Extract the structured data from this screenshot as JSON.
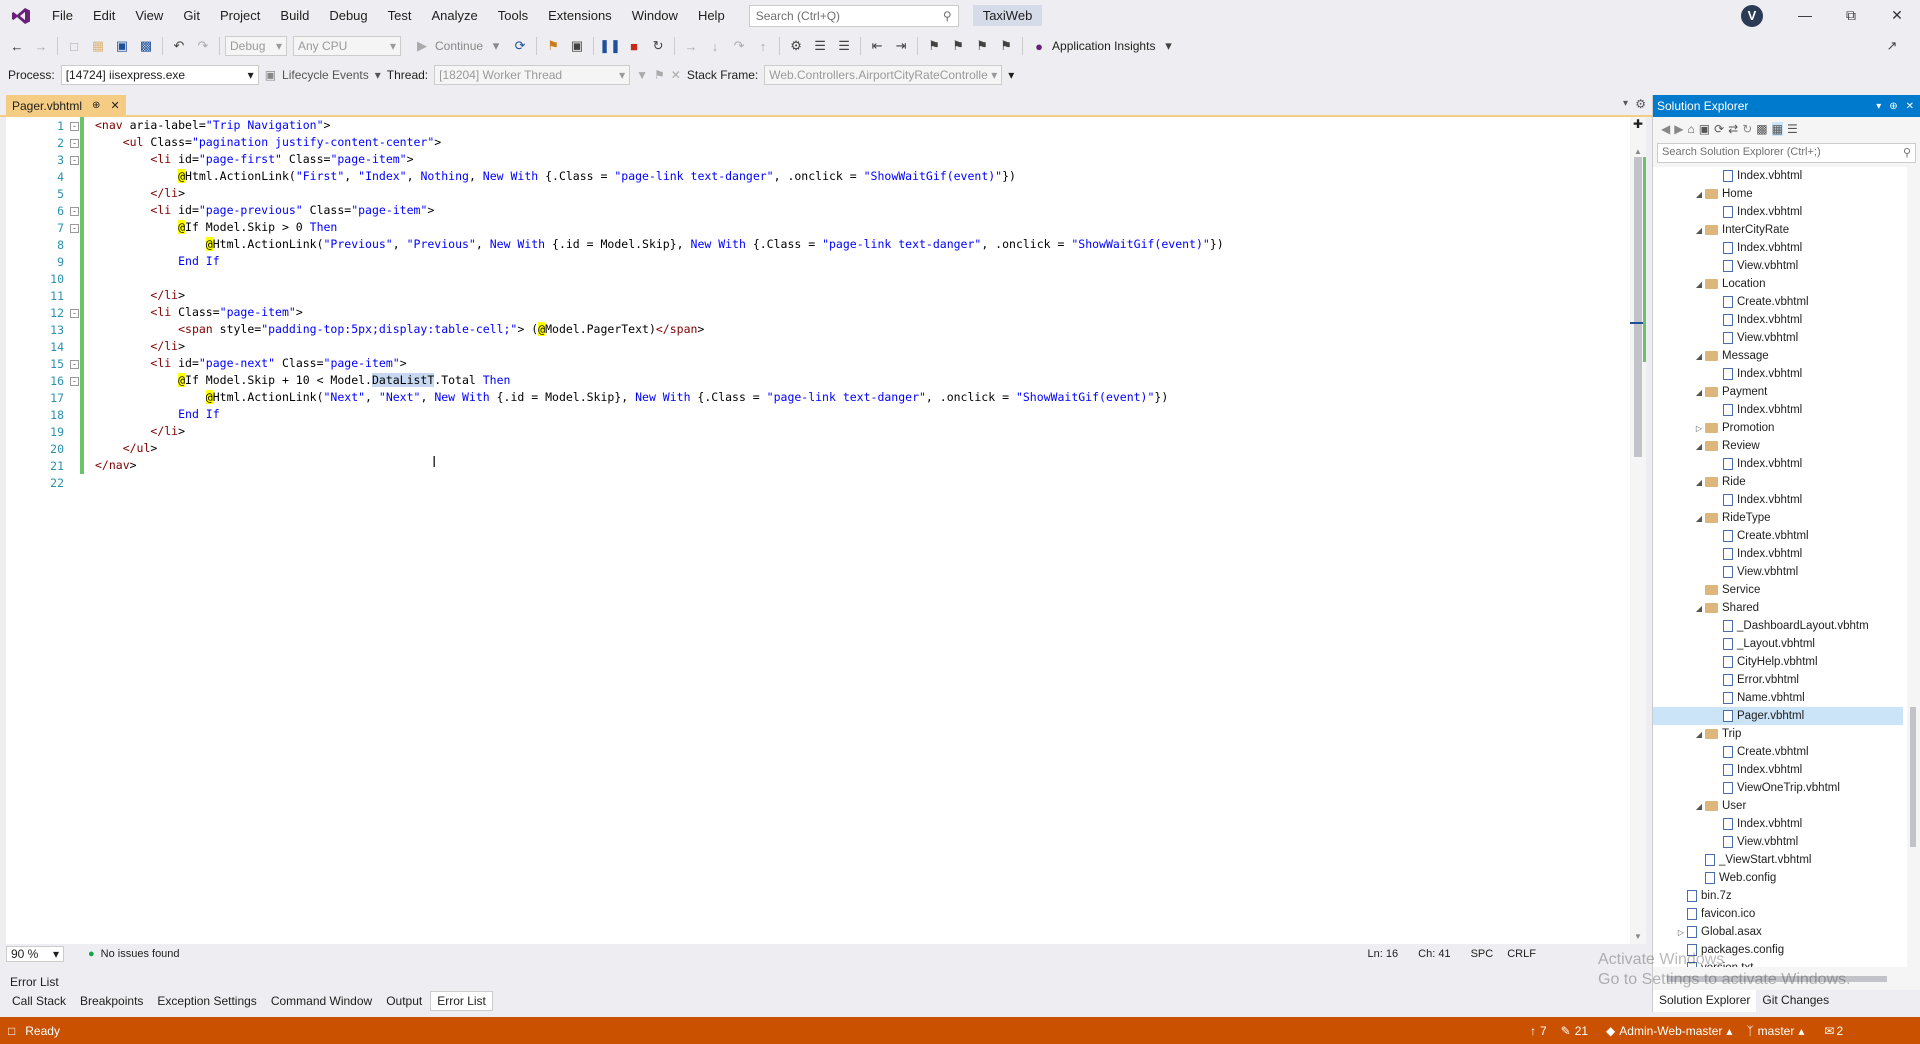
{
  "menu": {
    "items": [
      "File",
      "Edit",
      "View",
      "Git",
      "Project",
      "Build",
      "Debug",
      "Test",
      "Analyze",
      "Tools",
      "Extensions",
      "Window",
      "Help"
    ],
    "search_placeholder": "Search (Ctrl+Q)",
    "solution_name": "TaxiWeb",
    "avatar_letter": "V"
  },
  "toolbar1": {
    "config": "Debug",
    "platform": "Any CPU",
    "continue_label": "Continue",
    "app_insights": "Application Insights"
  },
  "toolbar2": {
    "process_label": "Process:",
    "process_value": "[14724] iisexpress.exe",
    "lifecycle_label": "Lifecycle Events",
    "thread_label": "Thread:",
    "thread_value": "[18204] Worker Thread",
    "stack_label": "Stack Frame:",
    "stack_value": "Web.Controllers.AirportCityRateControlle"
  },
  "editor": {
    "tab_name": "Pager.vbhtml",
    "zoom": "90 %",
    "issues": "No issues found",
    "ln": "Ln: 16",
    "ch": "Ch: 41",
    "spc": "SPC",
    "crlf": "CRLF",
    "lines": [
      "<nav aria-label=\"Trip Navigation\">",
      "    <ul Class=\"pagination justify-content-center\">",
      "        <li id=\"page-first\" Class=\"page-item\">",
      "            @Html.ActionLink(\"First\", \"Index\", Nothing, New With {.Class = \"page-link text-danger\", .onclick = \"ShowWaitGif(event)\"})",
      "        </li>",
      "        <li id=\"page-previous\" Class=\"page-item\">",
      "            @If Model.Skip > 0 Then",
      "                @Html.ActionLink(\"Previous\", \"Previous\", New With {.id = Model.Skip}, New With {.Class = \"page-link text-danger\", .onclick = \"ShowWaitGif(event)\"})",
      "            End If",
      "",
      "        </li>",
      "        <li Class=\"page-item\">",
      "            <span style=\"padding-top:5px;display:table-cell;\"> (@Model.PagerText)</span>",
      "        </li>",
      "        <li id=\"page-next\" Class=\"page-item\">",
      "            @If Model.Skip + 10 < Model.DataListT.Total Then",
      "                @Html.ActionLink(\"Next\", \"Next\", New With {.id = Model.Skip}, New With {.Class = \"page-link text-danger\", .onclick = \"ShowWaitGif(event)\"})",
      "            End If",
      "        </li>",
      "    </ul>",
      "</nav>",
      ""
    ]
  },
  "solution_explorer": {
    "title": "Solution Explorer",
    "search_placeholder": "Search Solution Explorer (Ctrl+;)",
    "tree": [
      {
        "label": "Index.vbhtml",
        "kind": "file",
        "indent": 3
      },
      {
        "label": "Home",
        "kind": "folder",
        "indent": 2,
        "expanded": true
      },
      {
        "label": "Index.vbhtml",
        "kind": "file",
        "indent": 3
      },
      {
        "label": "InterCityRate",
        "kind": "folder",
        "indent": 2,
        "expanded": true
      },
      {
        "label": "Index.vbhtml",
        "kind": "file",
        "indent": 3
      },
      {
        "label": "View.vbhtml",
        "kind": "file",
        "indent": 3
      },
      {
        "label": "Location",
        "kind": "folder",
        "indent": 2,
        "expanded": true
      },
      {
        "label": "Create.vbhtml",
        "kind": "file",
        "indent": 3
      },
      {
        "label": "Index.vbhtml",
        "kind": "file",
        "indent": 3
      },
      {
        "label": "View.vbhtml",
        "kind": "file",
        "indent": 3
      },
      {
        "label": "Message",
        "kind": "folder",
        "indent": 2,
        "expanded": true
      },
      {
        "label": "Index.vbhtml",
        "kind": "file",
        "indent": 3
      },
      {
        "label": "Payment",
        "kind": "folder",
        "indent": 2,
        "expanded": true
      },
      {
        "label": "Index.vbhtml",
        "kind": "file",
        "indent": 3
      },
      {
        "label": "Promotion",
        "kind": "folder",
        "indent": 2,
        "expanded": false
      },
      {
        "label": "Review",
        "kind": "folder",
        "indent": 2,
        "expanded": true
      },
      {
        "label": "Index.vbhtml",
        "kind": "file",
        "indent": 3
      },
      {
        "label": "Ride",
        "kind": "folder",
        "indent": 2,
        "expanded": true
      },
      {
        "label": "Index.vbhtml",
        "kind": "file",
        "indent": 3
      },
      {
        "label": "RideType",
        "kind": "folder",
        "indent": 2,
        "expanded": true
      },
      {
        "label": "Create.vbhtml",
        "kind": "file",
        "indent": 3
      },
      {
        "label": "Index.vbhtml",
        "kind": "file",
        "indent": 3
      },
      {
        "label": "View.vbhtml",
        "kind": "file",
        "indent": 3
      },
      {
        "label": "Service",
        "kind": "folder",
        "indent": 2,
        "expanded": null
      },
      {
        "label": "Shared",
        "kind": "folder",
        "indent": 2,
        "expanded": true
      },
      {
        "label": "_DashboardLayout.vbhtm",
        "kind": "file",
        "indent": 3
      },
      {
        "label": "_Layout.vbhtml",
        "kind": "file",
        "indent": 3
      },
      {
        "label": "CityHelp.vbhtml",
        "kind": "file",
        "indent": 3
      },
      {
        "label": "Error.vbhtml",
        "kind": "file",
        "indent": 3
      },
      {
        "label": "Name.vbhtml",
        "kind": "file",
        "indent": 3
      },
      {
        "label": "Pager.vbhtml",
        "kind": "file",
        "indent": 3,
        "selected": true
      },
      {
        "label": "Trip",
        "kind": "folder",
        "indent": 2,
        "expanded": true
      },
      {
        "label": "Create.vbhtml",
        "kind": "file",
        "indent": 3
      },
      {
        "label": "Index.vbhtml",
        "kind": "file",
        "indent": 3
      },
      {
        "label": "ViewOneTrip.vbhtml",
        "kind": "file",
        "indent": 3
      },
      {
        "label": "User",
        "kind": "folder",
        "indent": 2,
        "expanded": true
      },
      {
        "label": "Index.vbhtml",
        "kind": "file",
        "indent": 3
      },
      {
        "label": "View.vbhtml",
        "kind": "file",
        "indent": 3
      },
      {
        "label": "_ViewStart.vbhtml",
        "kind": "file",
        "indent": 2
      },
      {
        "label": "Web.config",
        "kind": "file",
        "indent": 2
      },
      {
        "label": "bin.7z",
        "kind": "file",
        "indent": 1
      },
      {
        "label": "favicon.ico",
        "kind": "file",
        "indent": 1
      },
      {
        "label": "Global.asax",
        "kind": "file",
        "indent": 1,
        "expanded": false
      },
      {
        "label": "packages.config",
        "kind": "file",
        "indent": 1
      },
      {
        "label": "version.txt",
        "kind": "file",
        "indent": 1
      }
    ],
    "bottom_tabs": [
      "Solution Explorer",
      "Git Changes"
    ]
  },
  "bottom_panel": {
    "title": "Error List",
    "tabs": [
      "Call Stack",
      "Breakpoints",
      "Exception Settings",
      "Command Window",
      "Output",
      "Error List"
    ],
    "active_tab": "Error List"
  },
  "statusbar": {
    "ready": "Ready",
    "up_count": "7",
    "edit_count": "21",
    "repo": "Admin-Web-master",
    "branch": "master",
    "notifications": "2"
  },
  "watermark": "Activate Windows\nGo to Settings to activate Windows."
}
